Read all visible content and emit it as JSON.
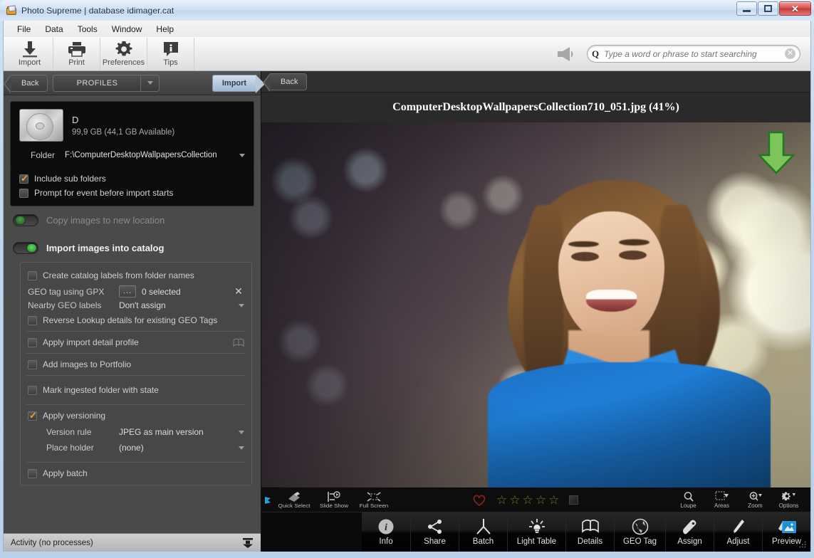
{
  "window": {
    "title": "Photo Supreme | database idimager.cat",
    "controls": {
      "minimize": "—",
      "maximize": "□",
      "close": "✕"
    }
  },
  "menu": {
    "items": [
      "File",
      "Data",
      "Tools",
      "Window",
      "Help"
    ]
  },
  "toolbar": {
    "buttons": [
      {
        "label": "Import",
        "icon": "download-arrow-icon"
      },
      {
        "label": "Print",
        "icon": "printer-icon"
      },
      {
        "label": "Preferences",
        "icon": "gear-icon"
      },
      {
        "label": "Tips",
        "icon": "info-balloon-icon"
      }
    ],
    "megaphone_icon": "megaphone-icon",
    "search": {
      "prefix": "Q",
      "value": "",
      "placeholder": "Type a word or phrase to start searching",
      "clear": "✕"
    }
  },
  "left_panel": {
    "back_label": "Back",
    "profiles_label": "PROFILES",
    "import_label": "Import",
    "drive": {
      "name": "D",
      "capacity": "99,9 GB (44,1 GB Available)",
      "folder_label": "Folder",
      "folder_value": "F:\\ComputerDesktopWallpapersCollection"
    },
    "drive_options": [
      {
        "label": "Include sub folders",
        "checked": true
      },
      {
        "label": "Prompt for event before import starts",
        "checked": false
      }
    ],
    "toggles": [
      {
        "label": "Copy images to new location",
        "on": false
      },
      {
        "label": "Import images into catalog",
        "on": true
      }
    ],
    "catalog_options": {
      "create_labels": {
        "label": "Create catalog labels from folder names",
        "checked": false
      },
      "gpx": {
        "key": "GEO tag using GPX",
        "button": "...",
        "value": "0 selected",
        "clear": "✕"
      },
      "nearby": {
        "key": "Nearby GEO labels",
        "value": "Don't assign"
      },
      "reverse_lookup": {
        "label": "Reverse Lookup details for existing GEO Tags",
        "checked": false
      },
      "detail_profile": {
        "label": "Apply import detail profile",
        "checked": false,
        "icon": "book-icon"
      },
      "portfolio": {
        "label": "Add images to Portfolio",
        "checked": false
      },
      "mark_state": {
        "label": "Mark ingested folder with state",
        "checked": false
      },
      "versioning": {
        "label": "Apply versioning",
        "checked": true
      },
      "version_rule": {
        "key": "Version rule",
        "value": "JPEG as main version"
      },
      "place_holder": {
        "key": "Place holder",
        "value": "(none)"
      },
      "batch": {
        "label": "Apply batch",
        "checked": false
      }
    },
    "status": {
      "text": "Activity (no processes)",
      "icon": "collapse-down-icon"
    }
  },
  "right_panel": {
    "back_label": "Back",
    "image_title": "ComputerDesktopWallpapersCollection710_051.jpg (41%)",
    "overlay_icon": "green-down-arrow-icon",
    "image_tools_left": [
      {
        "label": "Quick Select",
        "icon": "quick-select-icon"
      },
      {
        "label": "Slide Show",
        "icon": "slideshow-icon"
      },
      {
        "label": "Full Screen",
        "icon": "fullscreen-icon"
      }
    ],
    "rating": {
      "heart_icon": "heart-icon",
      "stars": [
        "☆",
        "☆",
        "☆",
        "☆",
        "☆"
      ],
      "star_count": 0,
      "color_chip": "color-label-chip"
    },
    "image_tools_right": [
      {
        "label": "Loupe",
        "icon": "magnifier-icon"
      },
      {
        "label": "Areas",
        "icon": "areas-icon"
      },
      {
        "label": "Zoom",
        "icon": "zoom-icon"
      },
      {
        "label": "Options",
        "icon": "options-gear-icon"
      }
    ],
    "nav_buttons": [
      {
        "label": "Info",
        "icon": "info-icon",
        "active": false
      },
      {
        "label": "Share",
        "icon": "share-icon",
        "active": false
      },
      {
        "label": "Batch",
        "icon": "batch-icon",
        "active": false
      },
      {
        "label": "Light Table",
        "icon": "lightbulb-icon",
        "active": false
      },
      {
        "label": "Details",
        "icon": "book-open-icon",
        "active": false
      },
      {
        "label": "GEO Tag",
        "icon": "globe-icon",
        "active": false
      },
      {
        "label": "Assign",
        "icon": "tag-icon",
        "active": false
      },
      {
        "label": "Adjust",
        "icon": "brush-icon",
        "active": false
      },
      {
        "label": "Preview",
        "icon": "preview-icon",
        "active": true
      }
    ]
  },
  "colors": {
    "accent_blue": "#1f7fd8",
    "check_orange": "#f0a22a",
    "toggle_green": "#2fbf2f",
    "arrow_green": "#6fbf4a",
    "star_gold": "#8a7326",
    "heart_red": "#8e1f1f",
    "titlebar_blue": "#c2d7ee"
  }
}
